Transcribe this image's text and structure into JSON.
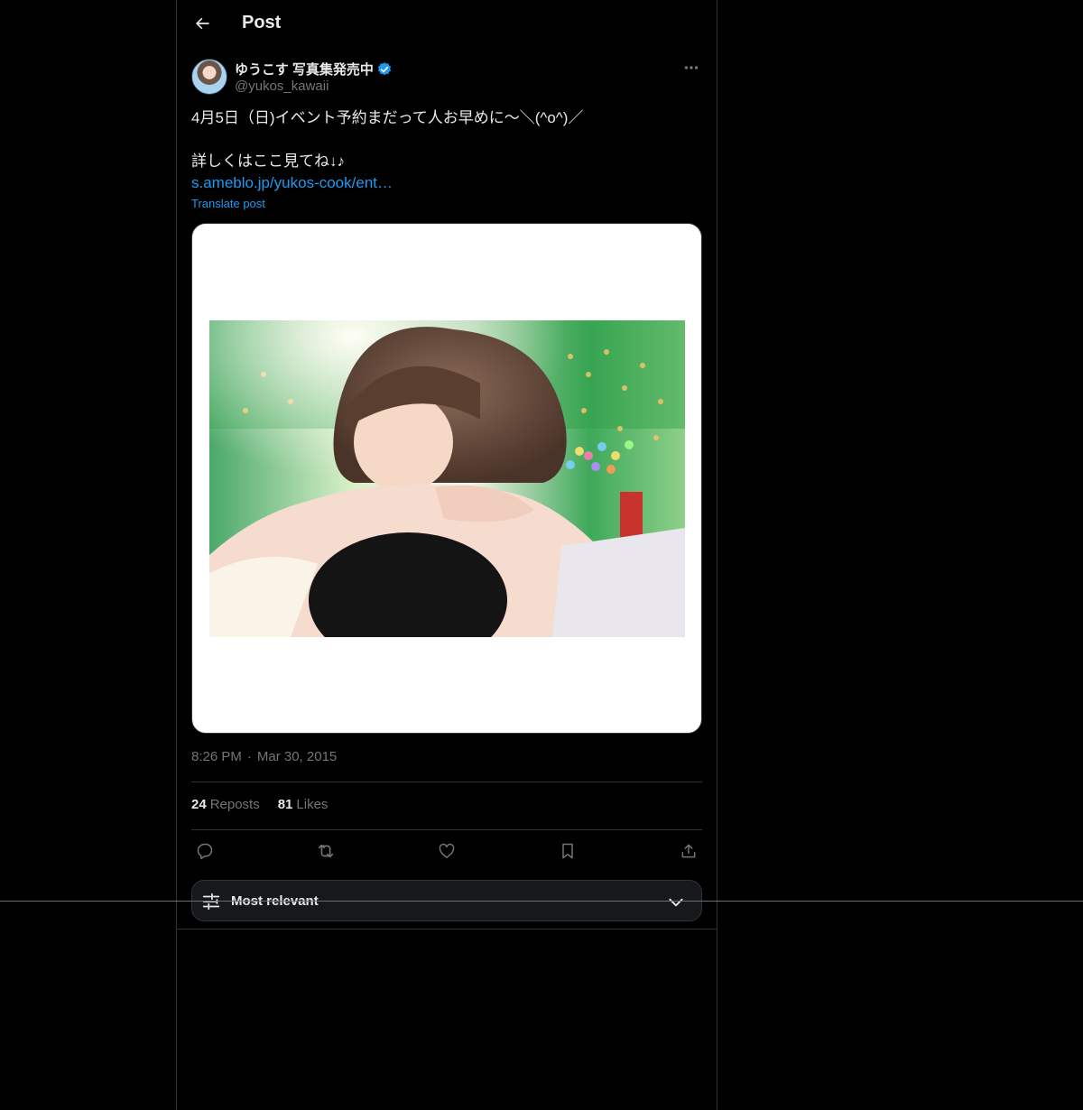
{
  "header": {
    "title": "Post",
    "back_icon": "arrow-left-icon"
  },
  "author": {
    "display_name": "ゆうこす 写真集発売中",
    "handle": "@yukos_kawaii",
    "verified": true,
    "verified_color": "#1d9bf0"
  },
  "tweet": {
    "line1": "4月5日（日)イベント予約まだって人お早めに〜＼(^o^)／",
    "line2": "詳しくはここ見てね↓♪",
    "link": "s.ameblo.jp/yukos-cook/ent…",
    "translate": "Translate post"
  },
  "meta": {
    "time": "8:26 PM",
    "separator": "·",
    "date": "Mar 30, 2015"
  },
  "stats": {
    "reposts_count": "24",
    "reposts_label": "Reposts",
    "likes_count": "81",
    "likes_label": "Likes"
  },
  "actions": [
    "reply-icon",
    "repost-icon",
    "like-icon",
    "bookmark-icon",
    "share-icon"
  ],
  "sort": {
    "label": "Most relevant",
    "icon": "sliders-icon"
  },
  "colors": {
    "background": "#000000",
    "text": "#e7e9ea",
    "muted": "#71767b",
    "link": "#1d9bf0",
    "border": "#2f3336"
  }
}
